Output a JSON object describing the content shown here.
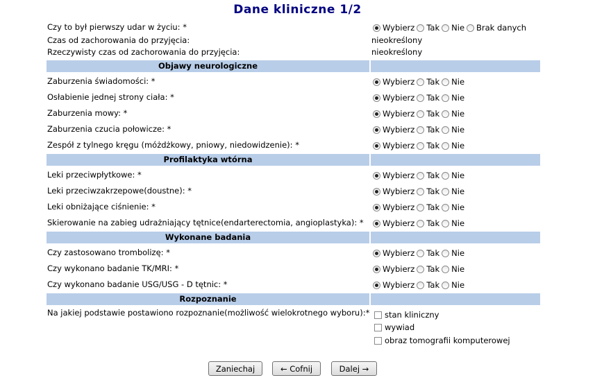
{
  "title": "Dane kliniczne 1/2",
  "options": {
    "wybierz": "Wybierz",
    "tak": "Tak",
    "nie": "Nie",
    "brak": "Brak danych"
  },
  "top": {
    "first_stroke": "Czy to był pierwszy udar w życiu: *",
    "time_label": "Czas od zachorowania do przyjęcia:",
    "time_value": "nieokreślony",
    "real_time_label": "Rzeczywisty czas od zachorowania do przyjęcia:",
    "real_time_value": "nieokreślony"
  },
  "sections": {
    "neuro": "Objawy neurologiczne",
    "prof": "Profilaktyka wtórna",
    "exams": "Wykonane badania",
    "diag": "Rozpoznanie"
  },
  "neuro": [
    "Zaburzenia świadomości: *",
    "Osłabienie jednej strony ciała: *",
    "Zaburzenia mowy: *",
    "Zaburzenia czucia połowicze: *",
    "Zespół z tylnego kręgu (móżdżkowy, pniowy, niedowidzenie): *"
  ],
  "prof": [
    "Leki przeciwpłytkowe: *",
    "Leki przeciwzakrzepowe(doustne): *",
    "Leki obniżające ciśnienie: *",
    "Skierowanie na zabieg udrażniający tętnice(endarterectomia, angioplastyka): *"
  ],
  "exams": [
    "Czy zastosowano trombolizę: *",
    "Czy wykonano badanie TK/MRI: *",
    "Czy wykonano badanie USG/USG - D tętnic: *"
  ],
  "diag": {
    "question": "Na jakiej podstawie postawiono rozpoznanie(możliwość wielokrotnego wyboru):*",
    "choices": [
      "stan kliniczny",
      "wywiad",
      "obraz tomografii komputerowej"
    ]
  },
  "buttons": {
    "cancel": "Zaniechaj",
    "back": "← Cofnij",
    "next": "Dalej →"
  }
}
